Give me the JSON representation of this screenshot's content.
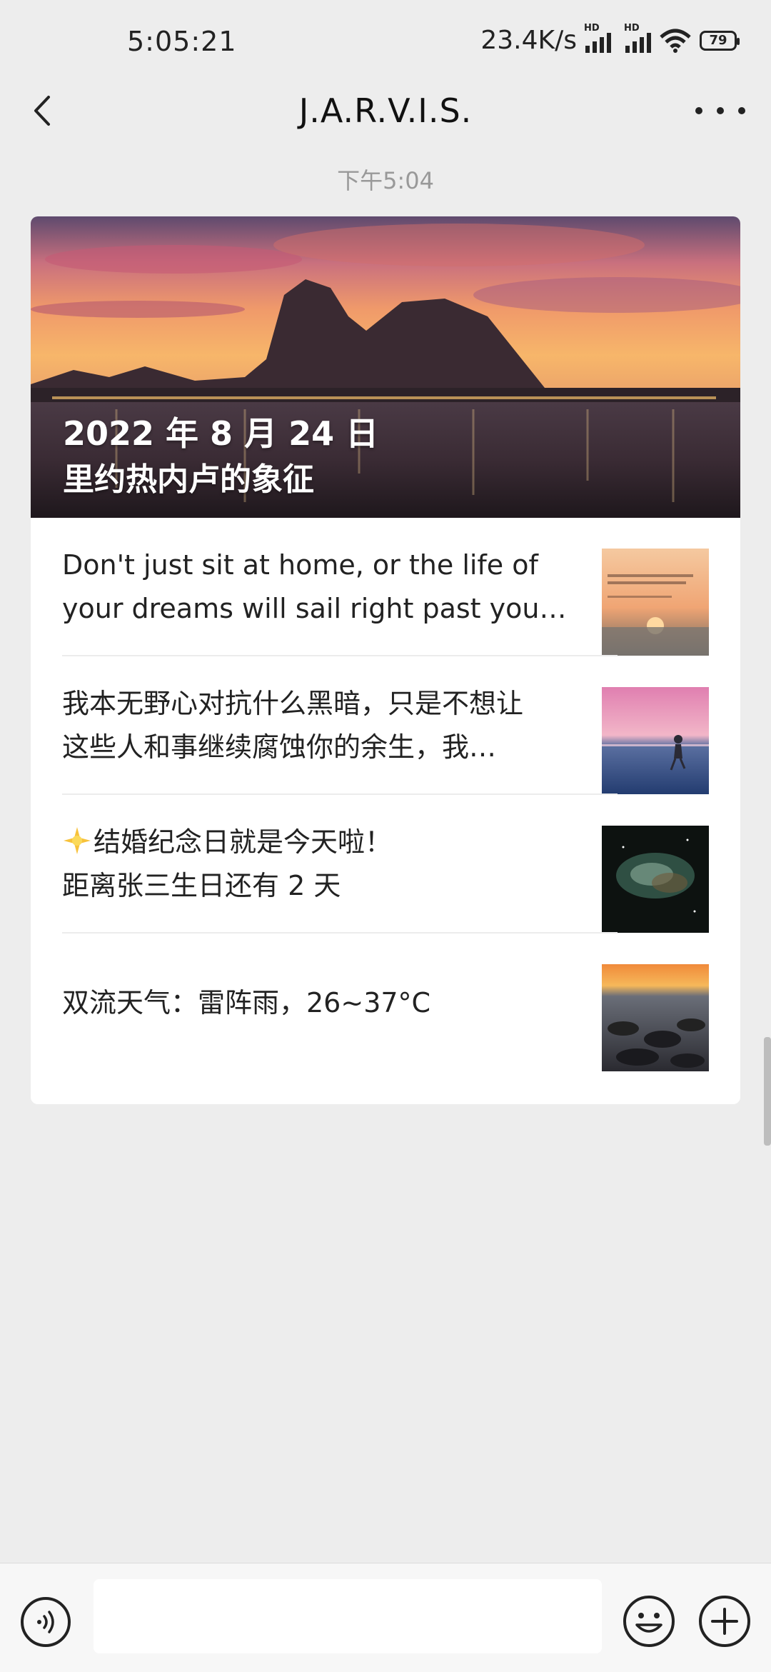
{
  "status_bar": {
    "time": "5:05:21",
    "network_speed": "23.4K/s",
    "signal_1_label": "HD",
    "signal_2_label": "HD",
    "battery": "79"
  },
  "header": {
    "title": "J.A.R.V.I.S.",
    "back_icon": "chevron-left-icon",
    "more_icon": "more-dots-icon"
  },
  "timestamp": "下午5:04",
  "card": {
    "hero": {
      "date": "2022 年 8 月 24 日",
      "title": "里约热内卢的象征"
    },
    "items": [
      {
        "line1": "Don't just sit at home, or the life of",
        "line2": "your dreams will sail right past you…",
        "thumb": "sunset-quote-thumbnail"
      },
      {
        "line1": "我本无野心对抗什么黑暗，只是不想让",
        "line2": "这些人和事继续腐蚀你的余生，我…",
        "thumb": "girl-running-beach-thumbnail"
      },
      {
        "line1": "结婚纪念日就是今天啦！",
        "line2": "距离张三生日还有 2 天",
        "icon": "sun-sparkle-icon",
        "thumb": "nebula-thumbnail"
      },
      {
        "line1": "双流天气：雷阵雨，26~37°C",
        "thumb": "sea-rocks-sunset-thumbnail"
      }
    ]
  },
  "bottom_bar": {
    "voice_icon": "voice-icon",
    "emoji_icon": "emoji-icon",
    "plus_icon": "plus-icon"
  },
  "colors": {
    "background": "#ededed",
    "card": "#ffffff",
    "text": "#222222",
    "muted": "#999999"
  }
}
